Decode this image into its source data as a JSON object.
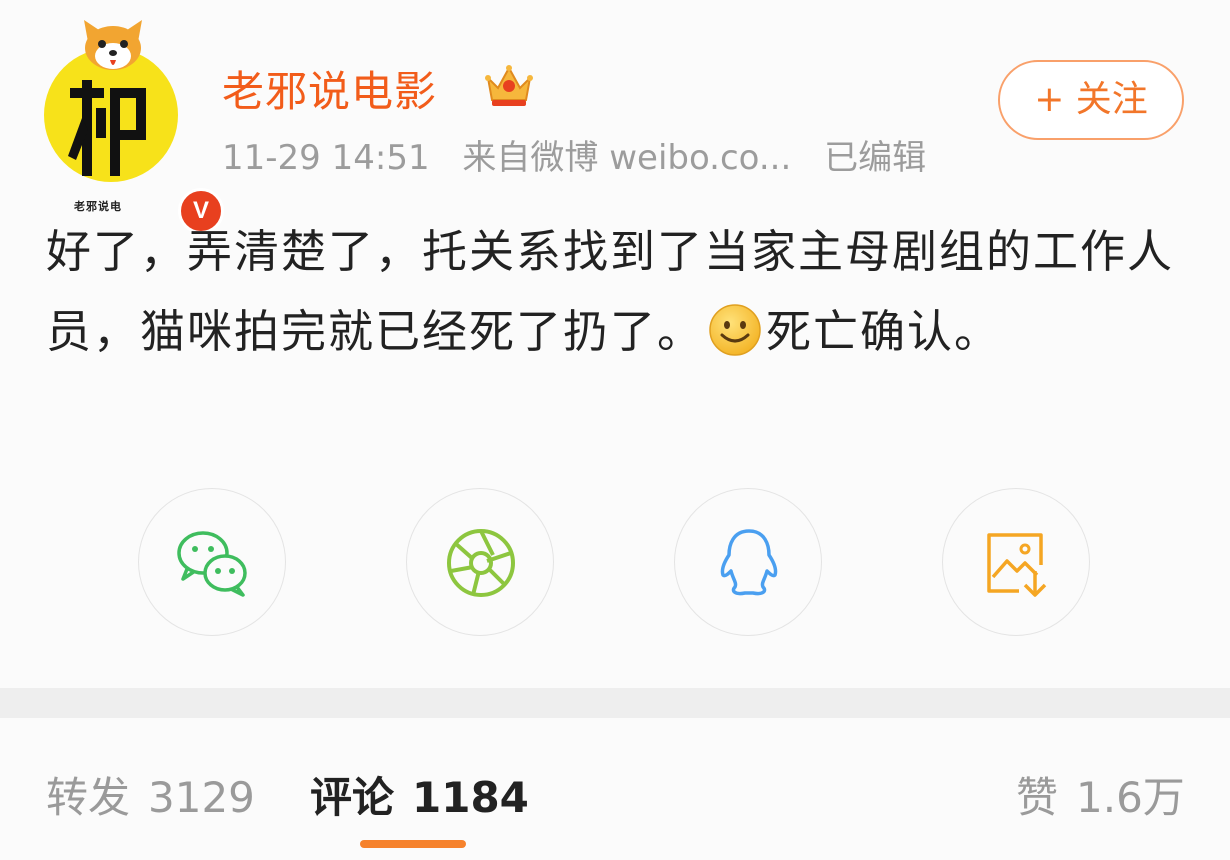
{
  "user": {
    "name": "老邪说电影",
    "avatar_text": "老邪说电",
    "verified_badge": "V"
  },
  "meta": {
    "time": "11-29 14:51",
    "source": "来自微博 weibo.co...",
    "edited": "已编辑"
  },
  "follow_label": "+ 关注",
  "post": {
    "text_before": "好了，弄清楚了，托关系找到了当家主母剧组的工作人员，猫咪拍完就已经死了扔了。",
    "text_after": "死亡确认。"
  },
  "share": {
    "items": [
      {
        "icon": "wechat-icon",
        "color": "#3fbd5e"
      },
      {
        "icon": "moments-icon",
        "color": "#8dc63f"
      },
      {
        "icon": "qq-icon",
        "color": "#4a9ff0"
      },
      {
        "icon": "save-image-icon",
        "color": "#f5a623"
      }
    ]
  },
  "tabs": {
    "repost_label": "转发",
    "repost_count": "3129",
    "comment_label": "评论",
    "comment_count": "1184",
    "like_label": "赞",
    "like_count": "1.6万"
  },
  "colors": {
    "accent": "#f25c1a",
    "underline": "#f6822c"
  }
}
